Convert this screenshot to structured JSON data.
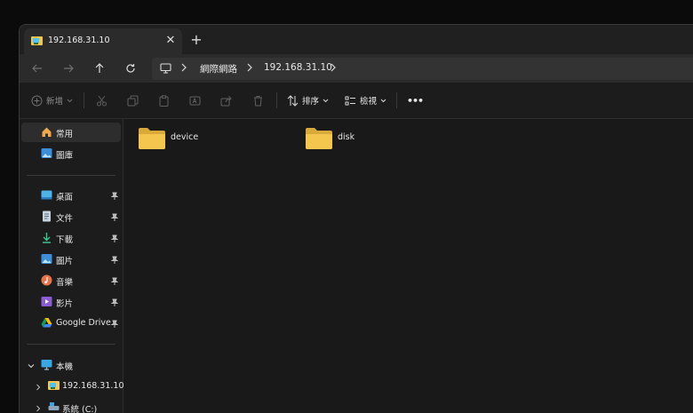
{
  "tab": {
    "title": "192.168.31.10",
    "close": "✕",
    "new_tab": "+"
  },
  "address": {
    "segments": [
      "網際網路",
      "192.168.31.10"
    ]
  },
  "commands": {
    "new_label": "新增",
    "sort_label": "排序",
    "view_label": "檢視",
    "more": "•••"
  },
  "sidebar": {
    "home": "常用",
    "gallery": "圖庫",
    "pinned": [
      {
        "label": "桌面"
      },
      {
        "label": "文件"
      },
      {
        "label": "下載"
      },
      {
        "label": "圖片"
      },
      {
        "label": "音樂"
      },
      {
        "label": "影片"
      },
      {
        "label": "Google Drive (I"
      }
    ],
    "this_pc": "本機",
    "network_host": "192.168.31.10",
    "system_drive": "系統 (C:)"
  },
  "folders": [
    {
      "name": "device"
    },
    {
      "name": "disk"
    }
  ],
  "colors": {
    "folder": "#f4c64e",
    "accent": "#4cc2ff"
  }
}
